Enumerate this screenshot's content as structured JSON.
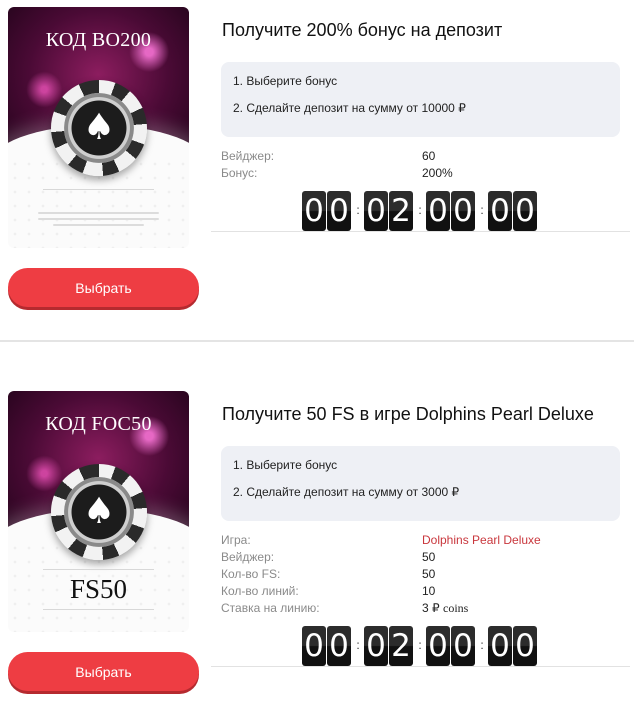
{
  "offers": [
    {
      "card_code": "КОД BO200",
      "card_fs": "",
      "button_label": "Выбрать",
      "title": "Получите 200% бонус на депозит",
      "steps": [
        "1. Выберите бонус",
        "2. Сделайте депозит на сумму от 10000 ₽"
      ],
      "details": [
        {
          "label": "Вейджер:",
          "value": "60"
        },
        {
          "label": "Бонус:",
          "value": "200%"
        }
      ],
      "timer": {
        "hours": "00",
        "minutes": "02",
        "seconds": "00",
        "frames": "00"
      }
    },
    {
      "card_code": "КОД FOC50",
      "card_fs": "FS50",
      "button_label": "Выбрать",
      "title": "Получите 50 FS в игре Dolphins Pearl Deluxe",
      "steps": [
        "1. Выберите бонус",
        "2. Сделайте депозит на сумму от 3000 ₽"
      ],
      "details": [
        {
          "label": "Игра:",
          "value": "Dolphins Pearl Deluxe"
        },
        {
          "label": "Вейджер:",
          "value": "50"
        },
        {
          "label": "Кол-во FS:",
          "value": "50"
        },
        {
          "label": "Кол-во линий:",
          "value": "10"
        },
        {
          "label": "Ставка на линию:",
          "value": "3 ₽",
          "unit": "coins"
        }
      ],
      "timer": {
        "hours": "00",
        "minutes": "02",
        "seconds": "00",
        "frames": "00"
      }
    }
  ],
  "colors": {
    "button": "#ee3d43",
    "link": "#c9373d",
    "steps_bg": "#eef0f5"
  },
  "icons": {
    "chip": "poker-chip-icon",
    "spade": "spade-icon"
  }
}
